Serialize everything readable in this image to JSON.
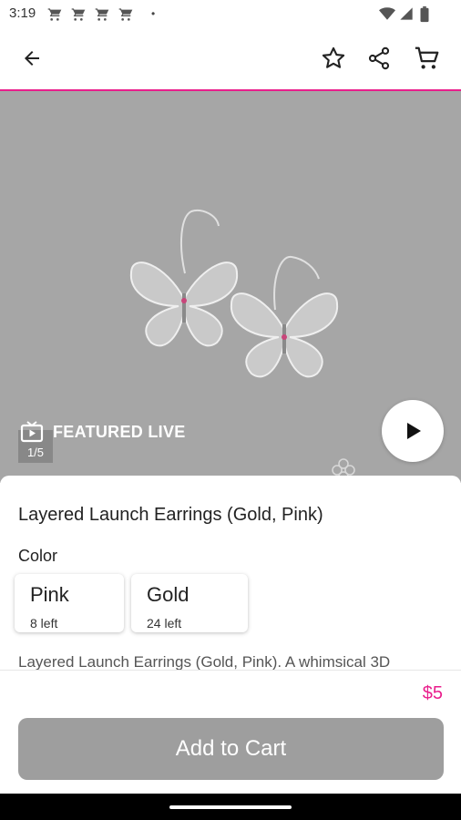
{
  "status_bar": {
    "time": "3:19",
    "dot": "•"
  },
  "hero": {
    "featured_label": "FEATURED LIVE",
    "image_counter": "1/5"
  },
  "product": {
    "title": "Layered Launch Earrings (Gold, Pink)",
    "color_label": "Color",
    "variants": [
      {
        "name": "Pink",
        "stock": "8 left"
      },
      {
        "name": "Gold",
        "stock": "24 left"
      }
    ],
    "description": "Layered Launch Earrings (Gold, Pink). A whimsical 3D"
  },
  "footer": {
    "price": "$5",
    "add_to_cart_label": "Add to Cart"
  },
  "colors": {
    "accent": "#e91e8c",
    "button_disabled": "#9e9e9e",
    "hero_background": "#a6a6a6"
  }
}
